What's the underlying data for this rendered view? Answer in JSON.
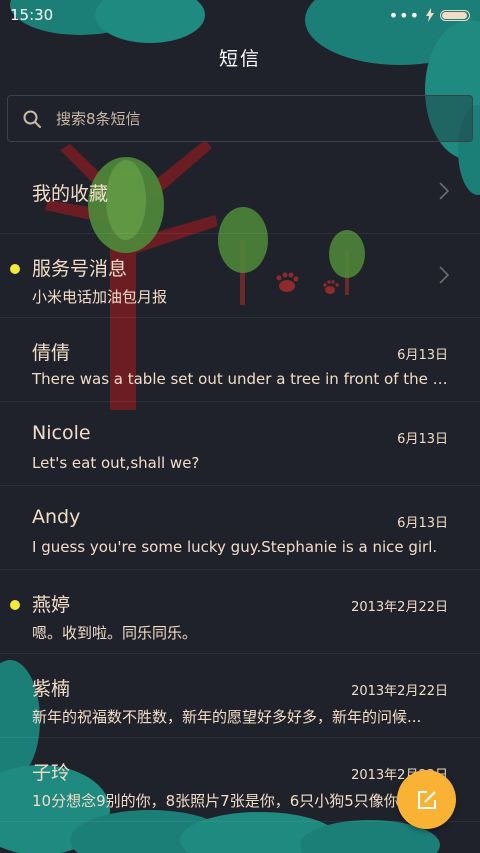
{
  "status_bar": {
    "time": "15:30",
    "signal": "•••",
    "battery_level": 0.95
  },
  "header": {
    "title": "短信"
  },
  "search": {
    "placeholder": "搜索8条短信"
  },
  "conversations": [
    {
      "name": "我的收藏",
      "snippet": "",
      "date": "",
      "unread": false,
      "chevron": true
    },
    {
      "name": "服务号消息",
      "snippet": "小米电话加油包月报",
      "date": "",
      "unread": true,
      "chevron": true
    },
    {
      "name": "倩倩",
      "snippet": "There was a table set out under a tree in front of the ho...",
      "date": "6月13日",
      "unread": false,
      "chevron": false
    },
    {
      "name": "Nicole",
      "snippet": "Let's eat out,shall we?",
      "date": "6月13日",
      "unread": false,
      "chevron": false
    },
    {
      "name": "Andy",
      "snippet": "I guess you're some lucky guy.Stephanie is a nice girl.",
      "date": "6月13日",
      "unread": false,
      "chevron": false
    },
    {
      "name": "燕婷",
      "snippet": "嗯。收到啦。同乐同乐。",
      "date": "2013年2月22日",
      "unread": true,
      "chevron": false
    },
    {
      "name": "紫楠",
      "snippet": "新年的祝福数不胜数，新年的愿望好多好多，新年的问候...",
      "date": "2013年2月22日",
      "unread": false,
      "chevron": false
    },
    {
      "name": "子玲",
      "snippet": "10分想念9别的你，8张照片7张是你，6只小狗5只像你",
      "date": "2013年2月22日",
      "unread": false,
      "chevron": false
    }
  ],
  "fab": {
    "icon": "compose-icon"
  },
  "colors": {
    "background": "#20222b",
    "text": "#f1dcc6",
    "accent": "#f9b233",
    "unread_dot": "#f5e93a",
    "foliage": "#1f8a80"
  }
}
